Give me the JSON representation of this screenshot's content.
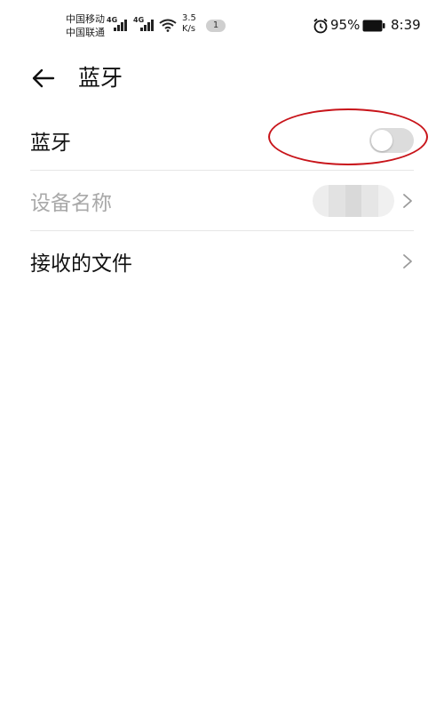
{
  "status_bar": {
    "carrier_1": "中国移动",
    "carrier_2": "中国联通",
    "network_1": "4G",
    "network_2": "4G",
    "net_speed_value": "3.5",
    "net_speed_unit": "K/s",
    "notification_count": "1",
    "battery_percent": "95%",
    "time": "8:39",
    "icons": [
      "signal-icon",
      "wifi-icon",
      "alarm-icon",
      "battery-icon"
    ]
  },
  "header": {
    "back_icon": "arrow-left-icon",
    "title": "蓝牙"
  },
  "settings": {
    "bluetooth": {
      "label": "蓝牙",
      "enabled": false
    },
    "device_name": {
      "label": "设备名称",
      "value_obscured": true
    },
    "received_files": {
      "label": "接收的文件"
    }
  },
  "colors": {
    "annotation_circle": "#c8141a",
    "toggle_off": "#dcdcdc",
    "disabled_text": "#a9a9a9",
    "divider": "#e6e6e6"
  }
}
